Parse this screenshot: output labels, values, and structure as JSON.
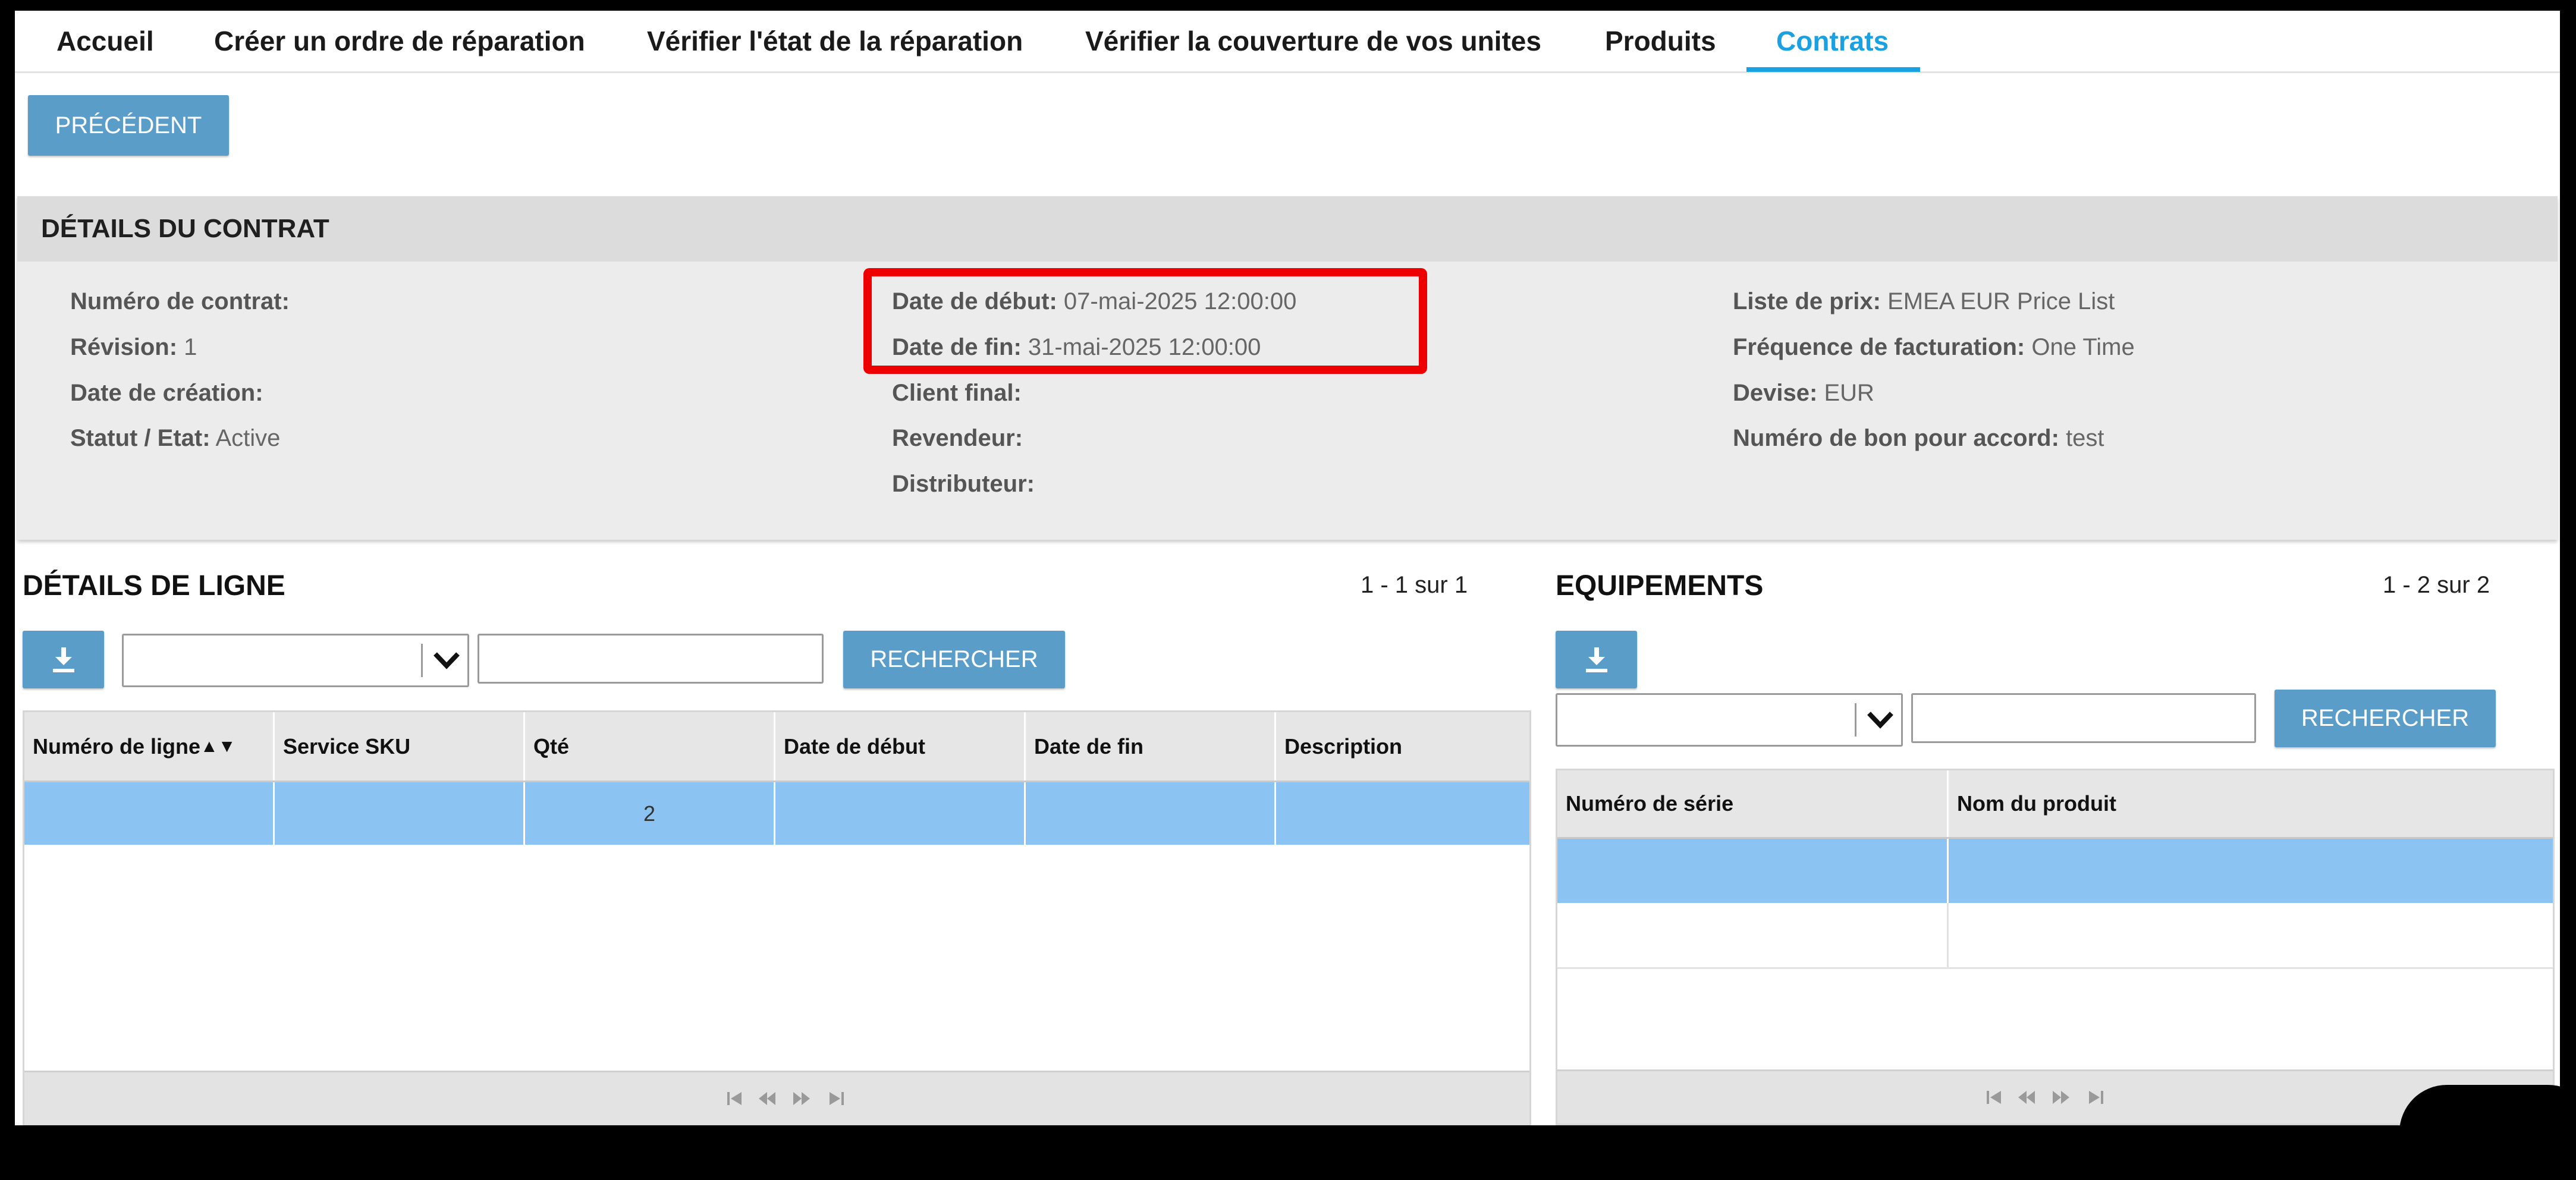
{
  "nav": {
    "tabs": [
      {
        "label": "Accueil",
        "active": false
      },
      {
        "label": "Créer un ordre de réparation",
        "active": false
      },
      {
        "label": "Vérifier l'état de la réparation",
        "active": false
      },
      {
        "label": "Vérifier la couverture de vos unites",
        "active": false
      },
      {
        "label": "Produits",
        "active": false
      },
      {
        "label": "Contrats",
        "active": true
      }
    ],
    "active_color": "#1ba1e2"
  },
  "back_button": {
    "label": "PRÉCÉDENT"
  },
  "contract": {
    "title": "DÉTAILS DU CONTRAT",
    "col1": [
      {
        "label": "Numéro de contrat:",
        "value": ""
      },
      {
        "label": "Révision:",
        "value": "1"
      },
      {
        "label": "Date de création:",
        "value": ""
      },
      {
        "label": "Statut / Etat:",
        "value": "Active"
      }
    ],
    "col2": [
      {
        "label": "Date de début:",
        "value": "07-mai-2025 12:00:00"
      },
      {
        "label": "Date de fin:",
        "value": "31-mai-2025 12:00:00"
      },
      {
        "label": "Client final:",
        "value": ""
      },
      {
        "label": "Revendeur:",
        "value": ""
      },
      {
        "label": "Distributeur:",
        "value": ""
      }
    ],
    "col3": [
      {
        "label": "Liste de prix:",
        "value": "EMEA EUR Price List"
      },
      {
        "label": "Fréquence de facturation:",
        "value": "One Time"
      },
      {
        "label": "Devise:",
        "value": "EUR"
      },
      {
        "label": "Numéro de bon pour accord:",
        "value": "test"
      }
    ],
    "highlight_color": "#ee0000"
  },
  "lines": {
    "title": "DÉTAILS DE LIGNE",
    "count": "1 - 1 sur 1",
    "search_label": "RECHERCHER",
    "select_value": "",
    "search_value": "",
    "columns": [
      "Numéro de ligne",
      "Service SKU",
      "Qté",
      "Date de début",
      "Date de fin",
      "Description"
    ],
    "sort_indicator": "▲▼",
    "rows": [
      [
        "",
        "",
        "2",
        "",
        "",
        ""
      ]
    ]
  },
  "equipment": {
    "title": "EQUIPEMENTS",
    "count": "1 - 2 sur 2",
    "search_label": "RECHERCHER",
    "select_value": "",
    "search_value": "",
    "columns": [
      "Numéro de série",
      "Nom du produit"
    ],
    "rows": [
      [
        "",
        ""
      ],
      [
        "",
        ""
      ]
    ]
  },
  "icons": {
    "download": "download-icon",
    "dropdown": "chevron-down-icon",
    "pager": [
      "first-page-icon",
      "prev-page-icon",
      "next-page-icon",
      "last-page-icon"
    ]
  },
  "colors": {
    "button": "#5b9dc9",
    "selected_row": "#8bc4f2"
  }
}
